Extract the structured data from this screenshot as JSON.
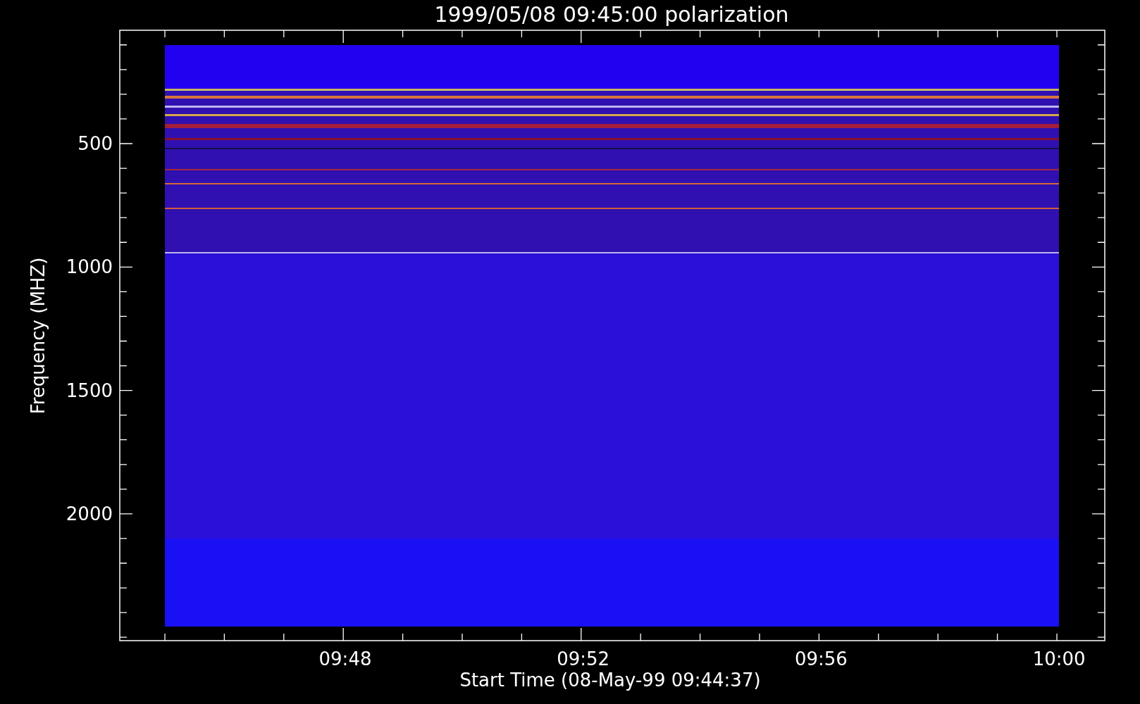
{
  "plot": {
    "title": "1999/05/08 09:45:00 polarization",
    "xlabel": "Start Time (08-May-99 09:44:37)",
    "ylabel": "Frequency (MHZ)",
    "xtick_labels": [
      "09:48",
      "09:52",
      "09:56",
      "10:00"
    ],
    "ytick_labels": [
      "500",
      "1000",
      "1500",
      "2000"
    ]
  }
}
